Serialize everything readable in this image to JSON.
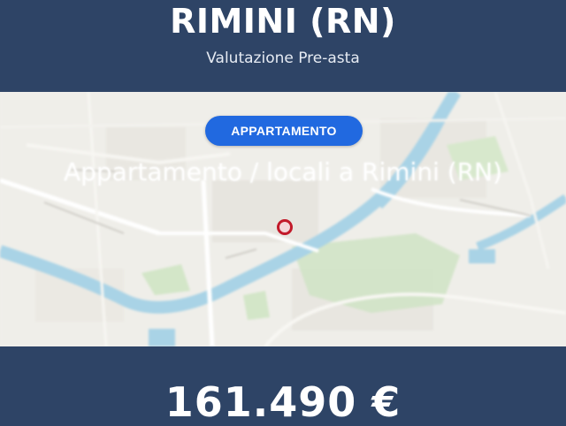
{
  "header": {
    "city": "RIMINI (RN)",
    "subtitle": "Valutazione Pre-asta"
  },
  "map": {
    "property_type": "APPARTAMENTO",
    "headline": "Appartamento / locali a Rimini (RN)",
    "pin_color": "#c21a2a",
    "river_color": "#a9d3e6",
    "park_color": "#cfe3c4"
  },
  "price": {
    "value": "161.490 €"
  }
}
